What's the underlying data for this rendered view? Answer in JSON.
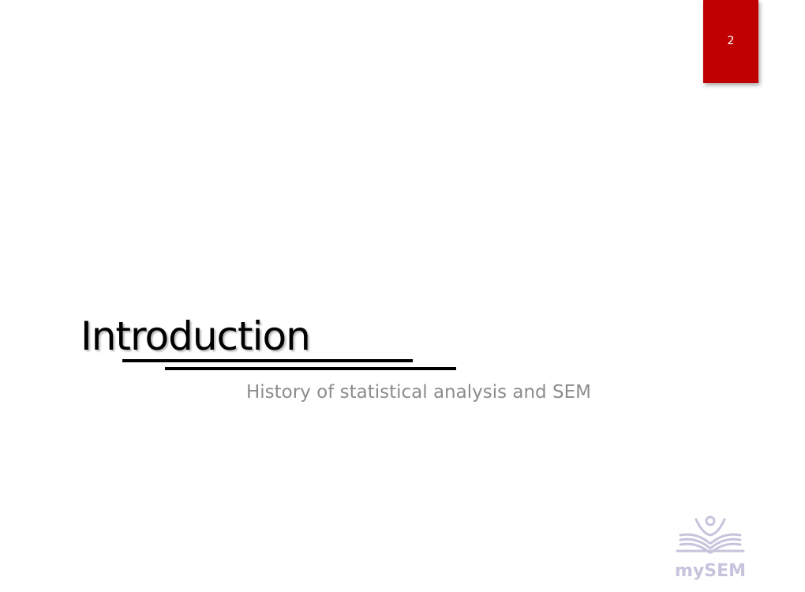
{
  "slide": {
    "page_number": "2",
    "title": "Introduction",
    "subtitle": "History of statistical analysis and SEM"
  },
  "logo": {
    "text": "mySEM",
    "icon": "reader-with-open-book-icon",
    "color": "#c8c3dc"
  },
  "colors": {
    "accent": "#c00000",
    "title": "#000000",
    "subtitle": "#8c8c8c",
    "background": "#ffffff"
  }
}
